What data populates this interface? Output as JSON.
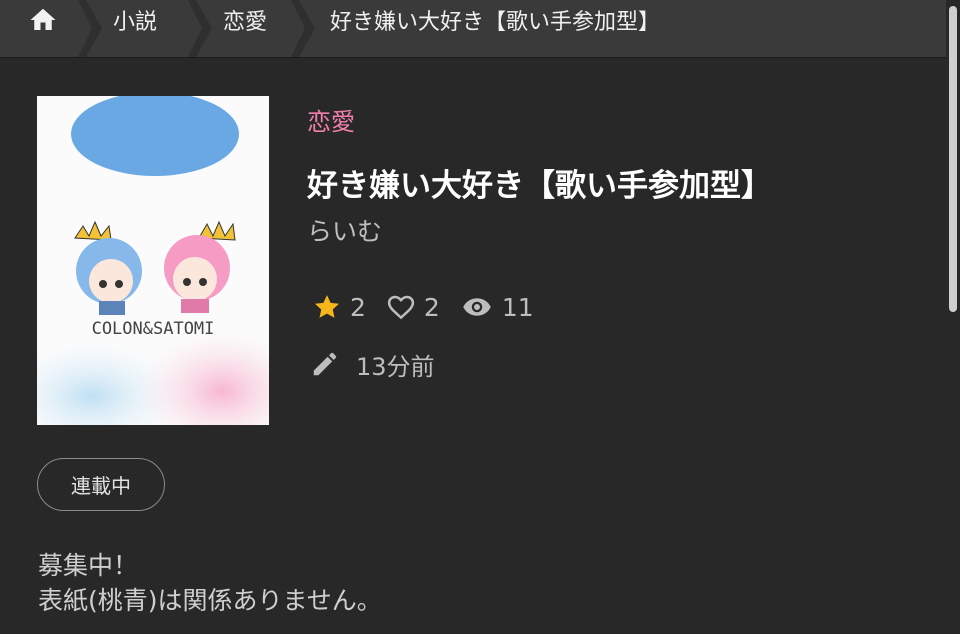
{
  "breadcrumb": {
    "home_icon": "home-icon",
    "items": [
      "小説",
      "恋愛",
      "好き嫌い大好き【歌い手参加型】"
    ]
  },
  "novel": {
    "genre": "恋愛",
    "title": "好き嫌い大好き【歌い手参加型】",
    "author": "らいむ",
    "stars": "2",
    "hearts": "2",
    "views": "11",
    "updated": "13分前",
    "status": "連載中",
    "description": [
      "募集中！",
      "表紙(桃青)は関係ありません。"
    ],
    "cover_text": "COLON&SATOMI"
  },
  "colors": {
    "accent_genre": "#f17fab",
    "star": "#f5b51b",
    "background": "#282828"
  }
}
